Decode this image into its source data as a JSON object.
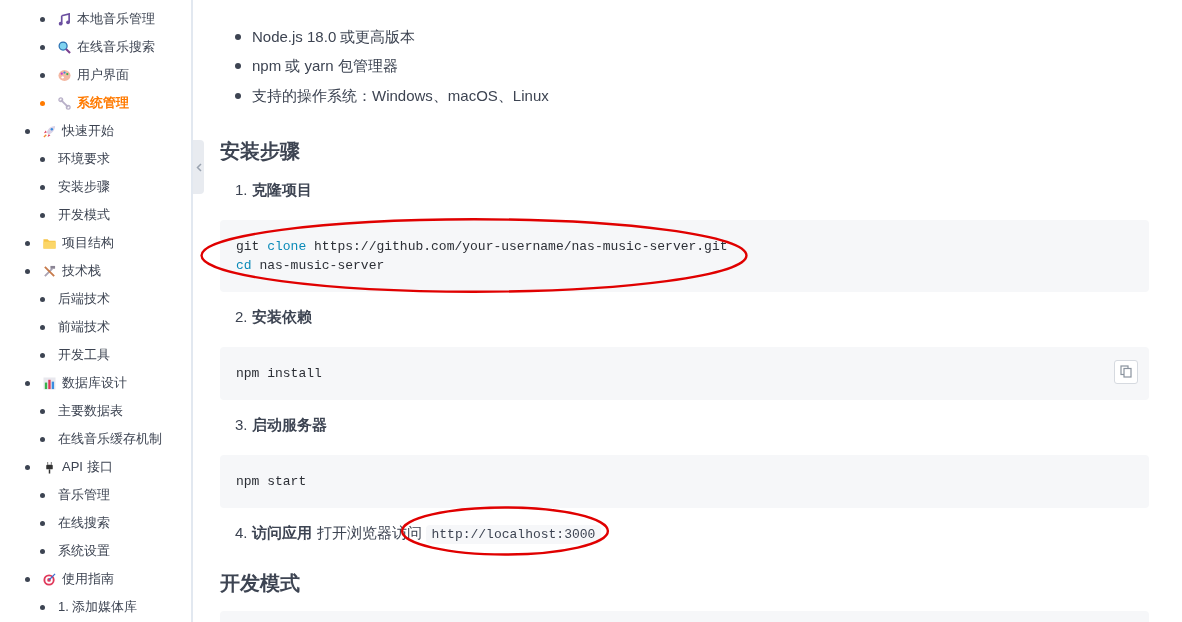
{
  "sidebar": {
    "continued_items": [
      {
        "label": "本地音乐管理",
        "selected": false
      },
      {
        "label": "在线音乐搜索",
        "selected": false
      },
      {
        "label": "用户界面",
        "selected": false
      },
      {
        "label": "系统管理",
        "selected": true
      }
    ],
    "items": [
      {
        "label": "快速开始",
        "selected": false,
        "children": [
          {
            "label": "环境要求",
            "selected": false
          },
          {
            "label": "安装步骤",
            "selected": false
          },
          {
            "label": "开发模式",
            "selected": false
          }
        ]
      },
      {
        "label": "项目结构",
        "selected": false
      },
      {
        "label": "技术栈",
        "selected": false,
        "children": [
          {
            "label": "后端技术",
            "selected": false
          },
          {
            "label": "前端技术",
            "selected": false
          },
          {
            "label": "开发工具",
            "selected": false
          }
        ]
      },
      {
        "label": "数据库设计",
        "selected": false,
        "children": [
          {
            "label": "主要数据表",
            "selected": false
          },
          {
            "label": "在线音乐缓存机制",
            "selected": false
          }
        ]
      },
      {
        "label": "API 接口",
        "selected": false,
        "children": [
          {
            "label": "音乐管理",
            "selected": false
          },
          {
            "label": "在线搜索",
            "selected": false
          },
          {
            "label": "系统设置",
            "selected": false
          }
        ]
      },
      {
        "label": "使用指南",
        "selected": false,
        "children": [
          {
            "label": "1. 添加媒体库",
            "selected": false
          }
        ]
      }
    ]
  },
  "content": {
    "requirements": [
      "Node.js 18.0 或更高版本",
      "npm 或 yarn 包管理器",
      "支持的操作系统：Windows、macOS、Linux"
    ],
    "install_heading": "安装步骤",
    "steps": [
      {
        "number": "1.",
        "title": "克隆项目",
        "circled": true,
        "copy_button": false,
        "code": [
          [
            {
              "kind": "plain",
              "text": "git "
            },
            {
              "kind": "keyword",
              "text": "clone"
            },
            {
              "kind": "plain",
              "text": " https://github.com/your-username/nas-music-server.git"
            }
          ],
          [
            {
              "kind": "keyword",
              "text": "cd"
            },
            {
              "kind": "plain",
              "text": " nas-music-server"
            }
          ]
        ]
      },
      {
        "number": "2.",
        "title": "安装依赖",
        "circled": false,
        "copy_button": true,
        "code": [
          [
            {
              "kind": "plain",
              "text": "npm install"
            }
          ]
        ]
      },
      {
        "number": "3.",
        "title": "启动服务器",
        "circled": false,
        "copy_button": false,
        "code": [
          [
            {
              "kind": "plain",
              "text": "npm start"
            }
          ]
        ]
      },
      {
        "number": "4.",
        "title": "访问应用",
        "text": "打开浏览器访问",
        "inline_code": "http://localhost:3000",
        "circled": true
      }
    ],
    "dev_heading": "开发模式",
    "dev_code_block": true
  }
}
